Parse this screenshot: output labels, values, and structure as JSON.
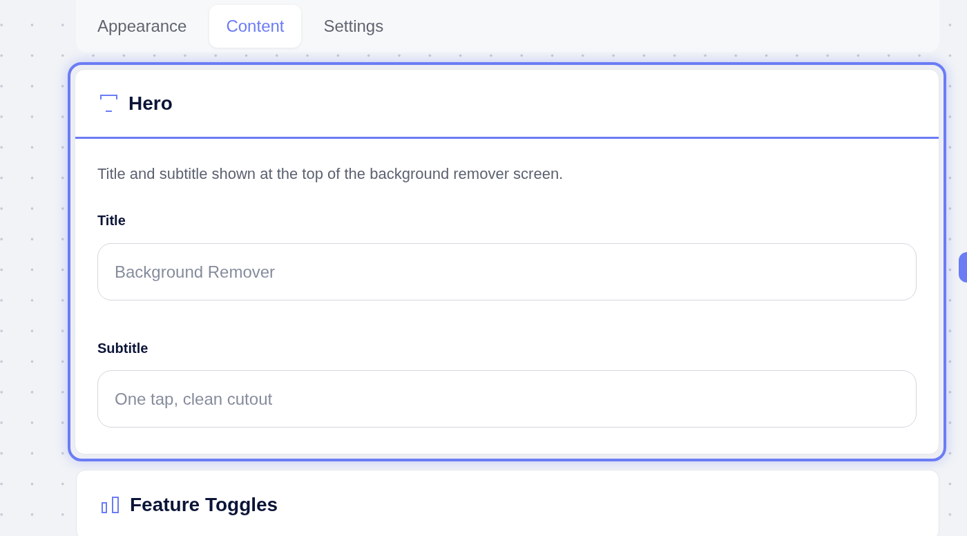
{
  "tabs": [
    {
      "label": "Appearance",
      "selected": false
    },
    {
      "label": "Content",
      "selected": true
    },
    {
      "label": "Settings",
      "selected": false
    }
  ],
  "sections": [
    {
      "title": "Hero",
      "selected": true,
      "description": "Title and subtitle shown at the top of the background remover screen.",
      "fields": [
        {
          "label": "Title",
          "placeholder": "Background Remover"
        },
        {
          "label": "Subtitle",
          "placeholder": "One tap, clean cutout"
        }
      ]
    },
    {
      "title": "Feature Toggles",
      "selected": false
    }
  ]
}
